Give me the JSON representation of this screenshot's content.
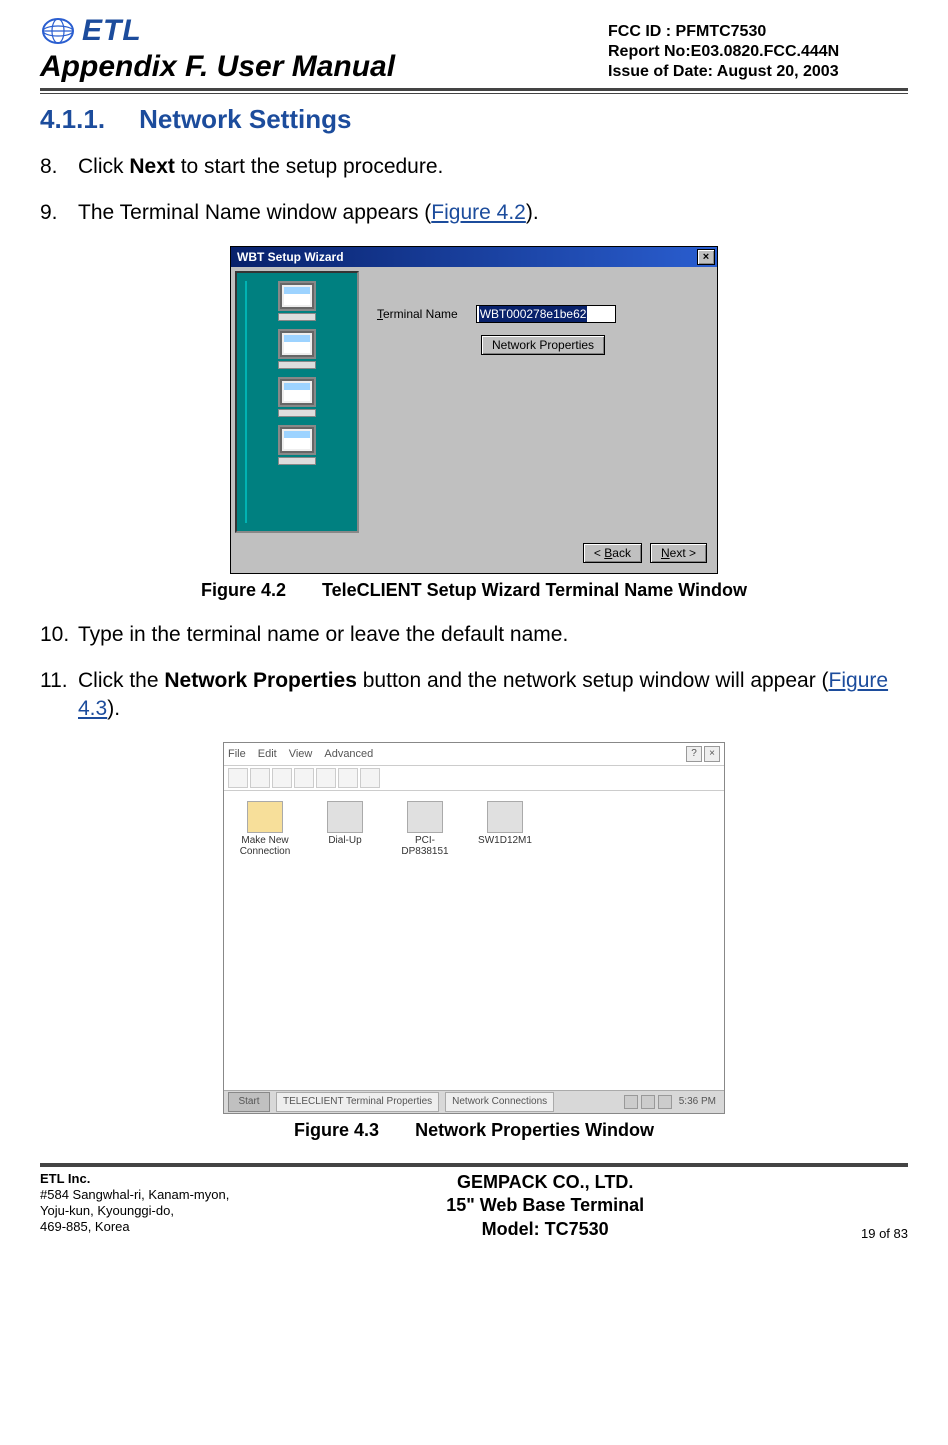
{
  "header": {
    "logo_text": "ETL",
    "appendix_title": "Appendix F. User Manual",
    "right": {
      "fcc_id": "FCC ID : PFMTC7530",
      "report_no": "Report No:E03.0820.FCC.444N",
      "issue_date": "Issue of Date:  August 20, 2003"
    }
  },
  "section": {
    "num": "4.1.1.",
    "title": "Network Settings"
  },
  "steps": {
    "s8": {
      "num": "8.",
      "pre": "Click ",
      "bold": "Next",
      "post": " to start the setup procedure."
    },
    "s9": {
      "num": "9.",
      "pre": "The Terminal Name window appears (",
      "link": "Figure 4.2",
      "post": ")."
    },
    "s10": {
      "num": "10.",
      "text": "Type in the terminal name or leave the default name."
    },
    "s11": {
      "num": "11.",
      "pre": "Click the ",
      "bold": "Network Properties",
      "mid": " button and the network setup window will appear (",
      "link": "Figure 4.3",
      "post": ")."
    }
  },
  "dialog42": {
    "title": "WBT Setup Wizard",
    "close": "×",
    "terminal_name_label": "Terminal Name",
    "terminal_name_hot": "T",
    "terminal_name_value": "WBT000278e1be62",
    "network_properties_btn": "Network Properties",
    "back_btn": "< Back",
    "back_hot": "B",
    "next_btn": "Next >",
    "next_hot": "N"
  },
  "caption42": {
    "num": "Figure 4.2",
    "text": "TeleCLIENT Setup Wizard Terminal Name Window"
  },
  "desk43": {
    "menu": [
      "File",
      "Edit",
      "View",
      "Advanced"
    ],
    "icons": [
      {
        "cap": "Make New Connection"
      },
      {
        "cap": "Dial-Up"
      },
      {
        "cap": "PCI-DP838151"
      },
      {
        "cap": "SW1D12M1"
      }
    ],
    "taskbar": {
      "start": "Start",
      "tasks": [
        "TELECLIENT Terminal Properties",
        "Network Connections"
      ],
      "clock": "5:36 PM"
    },
    "close": "×",
    "help": "?"
  },
  "caption43": {
    "num": "Figure 4.3",
    "text": "Network Properties Window"
  },
  "footer": {
    "left": {
      "company": "ETL Inc.",
      "addr1": "#584 Sangwhal-ri, Kanam-myon,",
      "addr2": "Yoju-kun, Kyounggi-do,",
      "addr3": "469-885, Korea"
    },
    "center": {
      "line1": "GEMPACK CO., LTD.",
      "line2": "15\" Web Base Terminal",
      "line3": "Model: TC7530"
    },
    "right": "19 of  83"
  }
}
